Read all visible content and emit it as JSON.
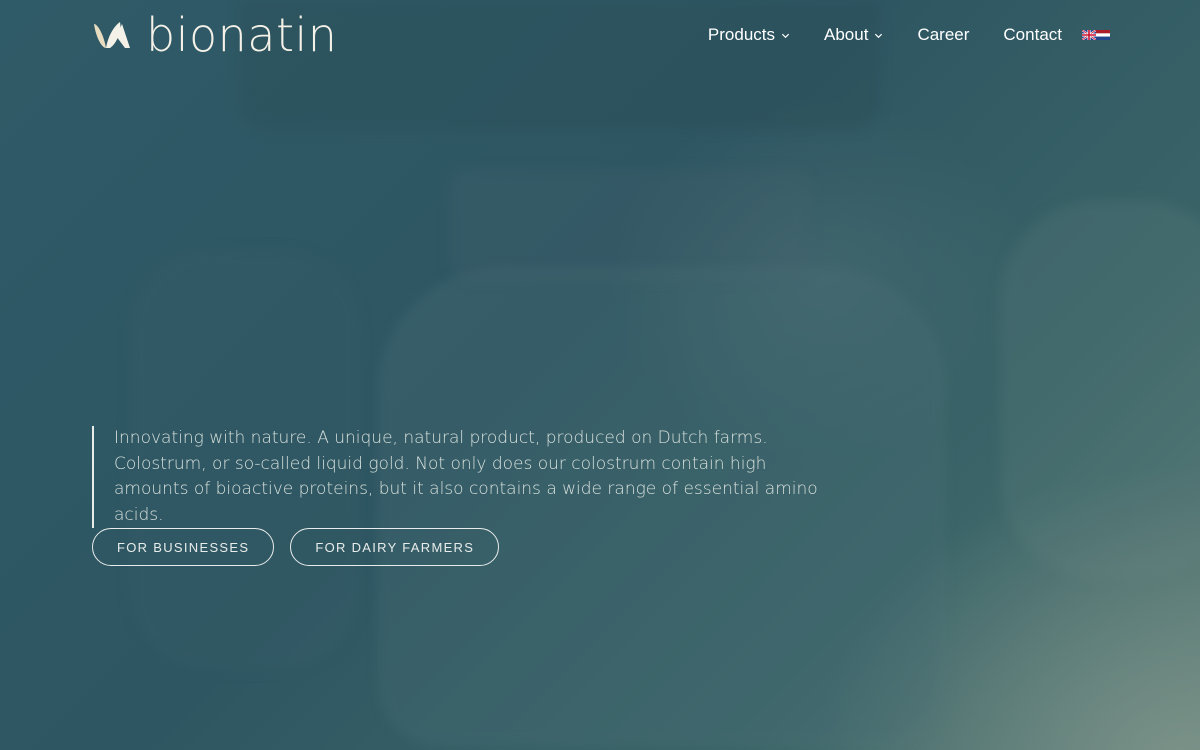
{
  "brand": {
    "name": "bionatin",
    "colors": {
      "logo": "#f4f1e8",
      "background": "#2f5a67",
      "text": "#ffffff"
    }
  },
  "nav": {
    "items": [
      {
        "label": "Products",
        "has_dropdown": true
      },
      {
        "label": "About",
        "has_dropdown": true
      },
      {
        "label": "Career",
        "has_dropdown": false
      },
      {
        "label": "Contact",
        "has_dropdown": false
      }
    ],
    "languages": [
      {
        "icon": "uk-flag-icon"
      },
      {
        "icon": "netherlands-flag-icon"
      }
    ]
  },
  "hero": {
    "intro_text": "Innovating with nature. A unique, natural product, produced on Dutch farms. Colostrum, or so-called liquid gold. Not only does our colostrum contain high amounts of bioactive proteins, but it also contains a wide range of essential amino acids.",
    "buttons": [
      {
        "label": "FOR BUSINESSES"
      },
      {
        "label": "FOR DAIRY FARMERS"
      }
    ]
  }
}
